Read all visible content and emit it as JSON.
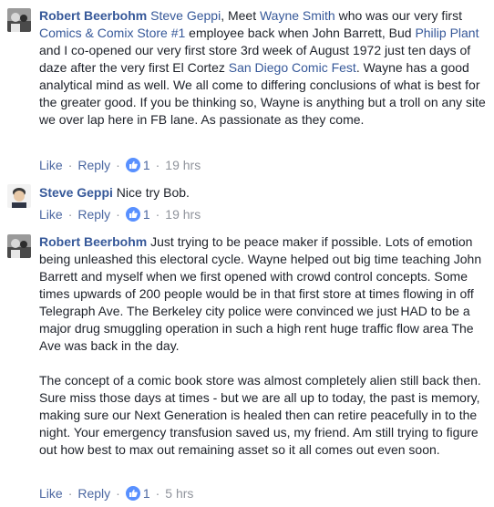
{
  "comments": [
    {
      "author": "Robert Beerbohm",
      "segments": [
        {
          "t": " "
        },
        {
          "t": "Steve Geppi",
          "link": true
        },
        {
          "t": ", Meet "
        },
        {
          "t": "Wayne Smith",
          "link": true
        },
        {
          "t": " who was our very first "
        },
        {
          "t": "Comics & Comix Store #1",
          "link": true
        },
        {
          "t": " employee back when John Barrett, Bud "
        },
        {
          "t": "Philip Plant",
          "link": true
        },
        {
          "t": " and I co-opened our very first store 3rd week of August 1972 just ten days of daze after the very first El Cortez "
        },
        {
          "t": "San Diego Comic Fest",
          "link": true
        },
        {
          "t": ". Wayne has a good analytical mind as well. We all come to differing conclusions of what is best for the greater good. If you be thinking so, Wayne is anything but a troll on any site we over lap here in FB lane. As passionate as they come."
        }
      ],
      "like_label": "Like",
      "reply_label": "Reply",
      "likes": "1",
      "time": "19 hrs"
    },
    {
      "author": "Steve Geppi",
      "text": " Nice try Bob.",
      "like_label": "Like",
      "reply_label": "Reply",
      "likes": "1",
      "time": "19 hrs"
    },
    {
      "author": "Robert Beerbohm",
      "text": " Just trying to be peace maker if possible. Lots of emotion being unleashed this electoral cycle. Wayne helped out big time teaching John Barrett and myself when we first opened with crowd control concepts. Some times upwards of 200 people would be in that first store at times flowing in off Telegraph Ave. The Berkeley city police were convinced we just HAD to be a major drug smuggling operation in such a high rent huge traffic flow area The Ave was back in the day.",
      "text2": "The concept of a comic book store was almost completely alien still back then. Sure miss those days at times - but we are all up to today, the past is memory, making sure our Next Generation is healed then can retire peacefully in to the night. Your emergency transfusion saved us, my friend. Am still trying to figure out how best to max out remaining asset so it all comes out even soon.",
      "like_label": "Like",
      "reply_label": "Reply",
      "likes": "1",
      "time": "5 hrs"
    }
  ],
  "colors": {
    "link": "#365899",
    "text": "#1d2129",
    "meta": "#90949c",
    "like_badge": "#5890ff"
  }
}
